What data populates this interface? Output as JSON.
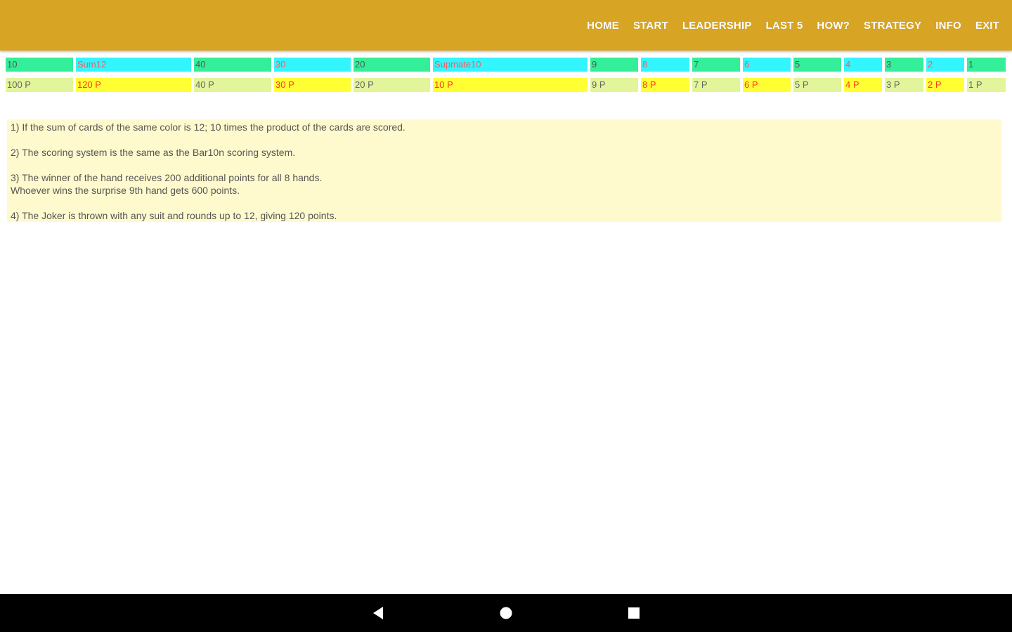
{
  "nav": {
    "items": [
      "HOME",
      "START",
      "LEADERSHIP",
      "LAST 5",
      "HOW?",
      "STRATEGY",
      "INFO",
      "EXIT"
    ]
  },
  "scores": {
    "labels": [
      "10",
      "Sum12",
      "40",
      "30",
      "20",
      "Supmate10",
      "9",
      "8",
      "7",
      "6",
      "5",
      "4",
      "3",
      "2",
      "1"
    ],
    "points": [
      "100 P",
      "120 P",
      "40 P",
      "30 P",
      "20 P",
      "10 P",
      "9 P",
      "8 P",
      "7 P",
      "6 P",
      "5 P",
      "4 P",
      "3 P",
      "2 P",
      "1 P"
    ]
  },
  "rules": {
    "r1": "1) If the sum of cards of the same color is 12; 10 times the product of the cards are scored.",
    "r2": "2) The scoring system is the same as the Bar10n scoring system.",
    "r3a": "3) The winner of the hand receives 200 additional points for all 8 hands.",
    "r3b": "Whoever wins the surprise 9th hand gets 600 points.",
    "r4": "4) The Joker is thrown with any suit and rounds up to 12, giving 120 points."
  },
  "system_nav": {
    "back_icon": "back-triangle-icon",
    "home_icon": "home-circle-icon",
    "recent_icon": "recents-square-icon"
  },
  "colors": {
    "app_bar": "#d7a424",
    "green_cell": "#33ef99",
    "cyan_cell": "#33f5ff",
    "light_cell": "#e3f59a",
    "yellow_cell": "#ffff33",
    "rules_bg": "#fffacd"
  }
}
